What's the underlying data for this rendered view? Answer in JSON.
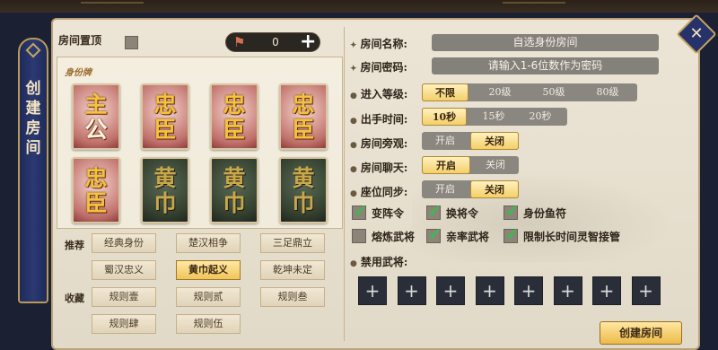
{
  "sidebar": {
    "title": "创建房间"
  },
  "close_icon": "close-x-icon",
  "left": {
    "room_top_label": "房间置顶",
    "currency": {
      "icon": "flag-coin-icon",
      "count": "0",
      "add_icon": "plus-icon"
    },
    "cards_title": "身份牌",
    "cards": [
      {
        "text": "主公",
        "style": "red"
      },
      {
        "text": "忠臣",
        "style": "red"
      },
      {
        "text": "忠臣",
        "style": "red"
      },
      {
        "text": "忠臣",
        "style": "red"
      },
      {
        "text": "忠臣",
        "style": "red"
      },
      {
        "text": "黄巾",
        "style": "dark"
      },
      {
        "text": "黄巾",
        "style": "dark"
      },
      {
        "text": "黄巾",
        "style": "dark"
      }
    ],
    "recommend_label": "推荐",
    "favorite_label": "收藏",
    "presets": {
      "p1": "经典身份",
      "p2": "楚汉相争",
      "p3": "三足鼎立",
      "p4": "蜀汉忠义",
      "p5": "黄巾起义",
      "p6": "乾坤未定",
      "p7": "规则壹",
      "p8": "规则贰",
      "p9": "规则叁",
      "p10": "规则肆",
      "p11": "规则伍"
    },
    "active_preset": "黄巾起义"
  },
  "form": {
    "room_name_label": "房间名称:",
    "room_name_value": "自选身份房间",
    "room_password_label": "房间密码:",
    "room_password_placeholder": "请输入1-6位数作为密码",
    "entry_level_label": "进入等级:",
    "entry_level_options": [
      "不限",
      "20级",
      "50级",
      "80级"
    ],
    "entry_level_selected": "不限",
    "turn_time_label": "出手时间:",
    "turn_time_options": [
      "10秒",
      "15秒",
      "20秒"
    ],
    "turn_time_selected": "10秒",
    "spectate_label": "房间旁观:",
    "spectate_options": [
      "开启",
      "关闭"
    ],
    "spectate_selected": "关闭",
    "chat_label": "房间聊天:",
    "chat_options": [
      "开启",
      "关闭"
    ],
    "chat_selected": "开启",
    "seat_sync_label": "座位同步:",
    "seat_sync_options": [
      "开启",
      "关闭"
    ],
    "seat_sync_selected": "关闭",
    "checks": [
      {
        "label": "变阵令",
        "checked": true
      },
      {
        "label": "换将令",
        "checked": true
      },
      {
        "label": "身份鱼符",
        "checked": true
      },
      {
        "label": "熔炼武将",
        "checked": false
      },
      {
        "label": "亲率武将",
        "checked": true
      },
      {
        "label": "限制长时间灵智接管",
        "checked": true
      }
    ],
    "banned_label": "禁用武将:",
    "banned_slot_icon": "plus-icon",
    "banned_slot_count": 8,
    "create_button": "创建房间"
  },
  "colors": {
    "accent_gold": "#f0c55a",
    "panel": "#ece5d6",
    "check_green": "#34c04a"
  }
}
